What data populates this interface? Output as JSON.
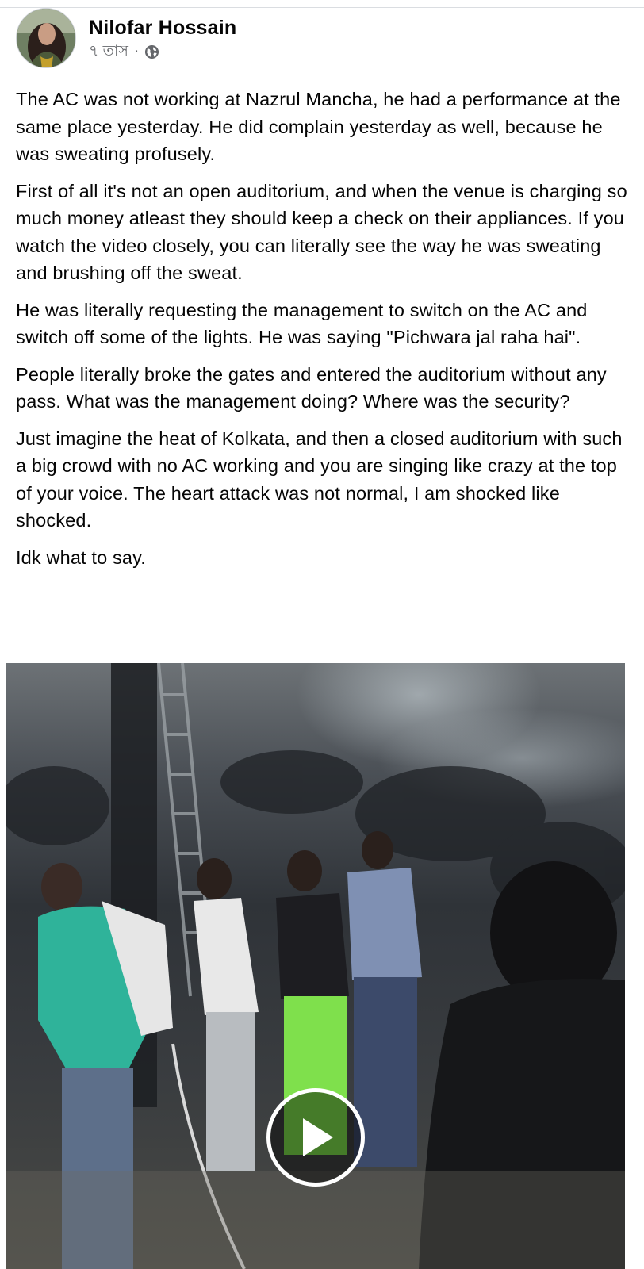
{
  "post": {
    "author": "Nilofar Hossain",
    "timestamp": "৭ তাস",
    "separator": "·",
    "privacy_icon": "globe-icon",
    "paragraphs": [
      "The AC was not working at Nazrul Mancha, he had a performance at the same place yesterday. He did complain yesterday as well, because he was sweating profusely.",
      "First of all it's not an open auditorium, and when the venue is charging so much money atleast they should keep a check on their appliances. If you watch the video closely, you can literally see the way he was sweating and brushing off the sweat.",
      "He was literally requesting the management to switch on the AC and switch off some of the lights. He was saying \"Pichwara jal raha hai\".",
      "People literally broke the gates and entered the auditorium without any pass. What was the management doing? Where was the security?",
      "Just imagine the heat of Kolkata, and then a closed auditorium with such a big crowd with no AC working and you are singing like crazy at the top of your voice. The heart attack was not normal, I am shocked like shocked.",
      "Idk what to say."
    ]
  },
  "video": {
    "play_icon": "play-icon"
  }
}
